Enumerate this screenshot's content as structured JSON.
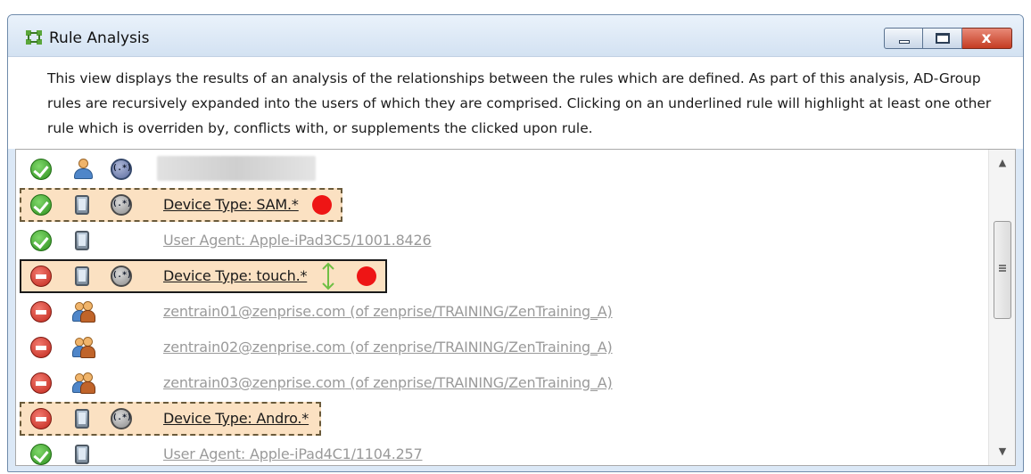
{
  "window": {
    "title": "Rule Analysis",
    "controls": {
      "minimize": "minimize",
      "maximize": "maximize",
      "close": "x"
    }
  },
  "description": "This view displays the results of an analysis of the relationships between the rules which are defined. As part of this analysis, AD-Group rules are recursively expanded into the users of which they are comprised. Clicking on an underlined rule will highlight at least one other rule which is overriden by, conflicts with, or supplements the clicked upon rule.",
  "rules": [
    {
      "status": "allowed",
      "type": "user",
      "regex": true,
      "text": "",
      "highlight": "none",
      "red_dot": false,
      "arrow": false,
      "redacted": true
    },
    {
      "status": "allowed",
      "type": "device",
      "regex": true,
      "text": "Device Type: SAM.*",
      "highlight": "dashed",
      "red_dot": true,
      "arrow": false
    },
    {
      "status": "allowed",
      "type": "device",
      "regex": false,
      "text": "User Agent: Apple-iPad3C5/1001.8426",
      "highlight": "none",
      "red_dot": false,
      "arrow": false
    },
    {
      "status": "denied",
      "type": "device",
      "regex": true,
      "text": "Device Type: touch.*",
      "highlight": "solid",
      "red_dot": true,
      "arrow": true
    },
    {
      "status": "denied",
      "type": "group",
      "regex": false,
      "text": "zentrain01@zenprise.com (of zenprise/TRAINING/ZenTraining_A)",
      "highlight": "none",
      "red_dot": false,
      "arrow": false
    },
    {
      "status": "denied",
      "type": "group",
      "regex": false,
      "text": "zentrain02@zenprise.com (of zenprise/TRAINING/ZenTraining_A)",
      "highlight": "none",
      "red_dot": false,
      "arrow": false
    },
    {
      "status": "denied",
      "type": "group",
      "regex": false,
      "text": "zentrain03@zenprise.com (of zenprise/TRAINING/ZenTraining_A)",
      "highlight": "none",
      "red_dot": false,
      "arrow": false
    },
    {
      "status": "denied",
      "type": "device",
      "regex": true,
      "text": "Device Type: Andro.*",
      "highlight": "dashed",
      "red_dot": false,
      "arrow": false
    },
    {
      "status": "allowed",
      "type": "device",
      "regex": false,
      "text": "User Agent: Apple-iPad4C1/1104.257",
      "highlight": "none",
      "red_dot": false,
      "arrow": false
    }
  ],
  "colors": {
    "highlight_fill": "#fbe1c2",
    "allowed": "#2e8f1e",
    "denied": "#c1271c",
    "red_dot": "#ee1515",
    "arrow": "#6fbf44"
  },
  "icons": {
    "app": "rule-analysis-icon",
    "allowed": "check-circle-icon",
    "denied": "no-entry-icon",
    "device": "device-icon",
    "user": "user-icon",
    "group": "user-group-icon",
    "regex": "regex-icon"
  }
}
